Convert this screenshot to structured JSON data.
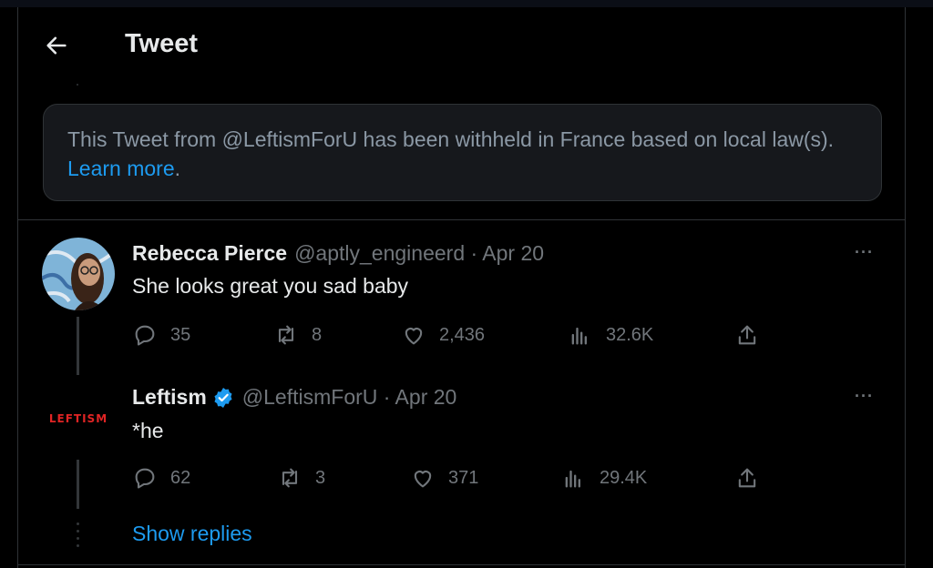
{
  "header": {
    "title": "Tweet"
  },
  "notice": {
    "text": "This Tweet from @LeftismForU has been withheld in France based on local law(s). ",
    "link": "Learn more",
    "suffix": "."
  },
  "tweets": [
    {
      "name": "Rebecca Pierce",
      "handle": "@aptly_engineerd · Apr 20",
      "text": "She looks great you sad baby",
      "replies": "35",
      "retweets": "8",
      "likes": "2,436",
      "views": "32.6K"
    },
    {
      "name": "Leftism",
      "verified": true,
      "handle": "@LeftismForU · Apr 20",
      "text": "*he",
      "avatar_label": "LEFTISM",
      "replies": "62",
      "retweets": "3",
      "likes": "371",
      "views": "29.4K"
    }
  ],
  "show_replies": "Show replies",
  "more_label": "···",
  "colors": {
    "background": "#000000",
    "accent": "#1d9bf0",
    "muted": "#71767b",
    "border": "#2f3336",
    "verified": "#1d9bf0",
    "logo_red": "#e02424"
  },
  "icons": [
    "back-arrow-icon",
    "reply-icon",
    "retweet-icon",
    "like-icon",
    "views-icon",
    "share-icon",
    "verified-badge-icon",
    "more-icon"
  ]
}
